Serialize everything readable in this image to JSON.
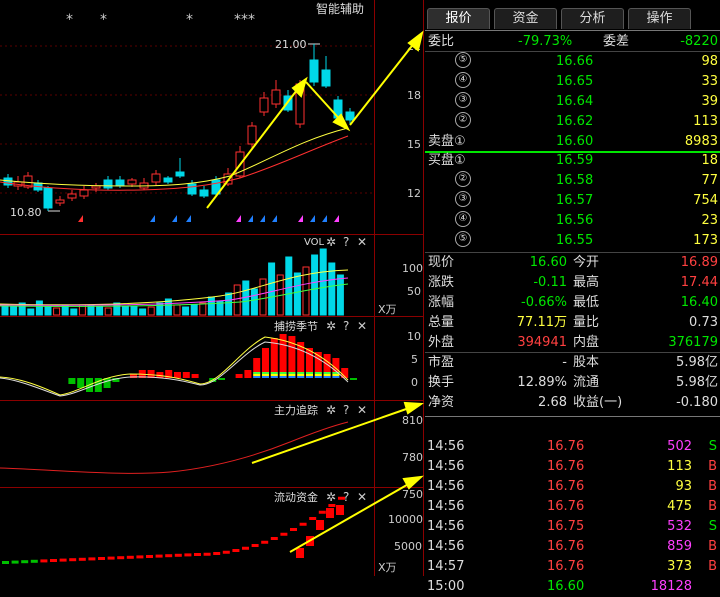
{
  "left": {
    "kline": {
      "title": "智能辅助",
      "stars": [
        "*",
        "*",
        "*",
        "***"
      ],
      "ticks": [
        "21",
        "18",
        "15",
        "12"
      ],
      "high_label": "21.00",
      "low_label": "10.80"
    },
    "vol": {
      "title": "VOL",
      "ticks": [
        "100",
        "50"
      ],
      "unit": "X万"
    },
    "hunt": {
      "title": "捕捞季节",
      "ticks": [
        "10",
        "5",
        "0"
      ]
    },
    "main": {
      "title": "主力追踪",
      "ticks": [
        "810",
        "780",
        "750"
      ]
    },
    "flow": {
      "title": "流动资金",
      "ticks": [
        "10000",
        "5000"
      ],
      "unit": "X万"
    },
    "panel_icons": {
      "gear": "✲",
      "help": "?",
      "close": "✕"
    }
  },
  "right": {
    "tabs": [
      "报价",
      "资金",
      "分析",
      "操作"
    ],
    "weibi": {
      "label": "委比",
      "value": "-79.73%",
      "label2": "委差",
      "value2": "-8220"
    },
    "sell": [
      {
        "idx": "⑤",
        "price": "16.66",
        "vol": "98"
      },
      {
        "idx": "④",
        "price": "16.65",
        "vol": "33"
      },
      {
        "idx": "③",
        "price": "16.64",
        "vol": "39"
      },
      {
        "idx": "②",
        "price": "16.62",
        "vol": "113"
      },
      {
        "label": "卖盘①",
        "price": "16.60",
        "vol": "8983"
      }
    ],
    "buy": [
      {
        "label": "买盘①",
        "price": "16.59",
        "vol": "18"
      },
      {
        "idx": "②",
        "price": "16.58",
        "vol": "77"
      },
      {
        "idx": "③",
        "price": "16.57",
        "vol": "754"
      },
      {
        "idx": "④",
        "price": "16.56",
        "vol": "23"
      },
      {
        "idx": "⑤",
        "price": "16.55",
        "vol": "173"
      }
    ],
    "quote": [
      {
        "l1": "现价",
        "v1": "16.60",
        "c1": "g",
        "l2": "今开",
        "v2": "16.89",
        "c2": "r"
      },
      {
        "l1": "涨跌",
        "v1": "-0.11",
        "c1": "g",
        "l2": "最高",
        "v2": "17.44",
        "c2": "r"
      },
      {
        "l1": "涨幅",
        "v1": "-0.66%",
        "c1": "g",
        "l2": "最低",
        "v2": "16.40",
        "c2": "g"
      },
      {
        "l1": "总量",
        "v1": "77.11万",
        "c1": "y",
        "l2": "量比",
        "v2": "0.73",
        "c2": "w"
      },
      {
        "l1": "外盘",
        "v1": "394941",
        "c1": "r",
        "l2": "内盘",
        "v2": "376179",
        "c2": "g"
      }
    ],
    "fin": [
      {
        "l1": "市盈",
        "v1": "-",
        "l2": "股本",
        "v2": "5.98亿"
      },
      {
        "l1": "换手",
        "v1": "12.89%",
        "l2": "流通",
        "v2": "5.98亿"
      },
      {
        "l1": "净资",
        "v1": "2.68",
        "l2": "收益(一)",
        "v2": "-0.180"
      }
    ],
    "ticks": [
      {
        "t": "14:56",
        "p": "16.76",
        "pc": "r",
        "v": "502",
        "vc": "mg",
        "s": "S",
        "sc": "g"
      },
      {
        "t": "14:56",
        "p": "16.76",
        "pc": "r",
        "v": "113",
        "vc": "y",
        "s": "B",
        "sc": "r"
      },
      {
        "t": "14:56",
        "p": "16.76",
        "pc": "r",
        "v": "93",
        "vc": "y",
        "s": "B",
        "sc": "r"
      },
      {
        "t": "14:56",
        "p": "16.76",
        "pc": "r",
        "v": "475",
        "vc": "y",
        "s": "B",
        "sc": "r"
      },
      {
        "t": "14:56",
        "p": "16.75",
        "pc": "r",
        "v": "532",
        "vc": "mg",
        "s": "S",
        "sc": "g"
      },
      {
        "t": "14:56",
        "p": "16.76",
        "pc": "r",
        "v": "859",
        "vc": "mg",
        "s": "B",
        "sc": "r"
      },
      {
        "t": "14:57",
        "p": "16.76",
        "pc": "r",
        "v": "373",
        "vc": "y",
        "s": "B",
        "sc": "r"
      },
      {
        "t": "15:00",
        "p": "16.60",
        "pc": "g",
        "v": "18128",
        "vc": "mg",
        "s": "",
        "sc": "w"
      }
    ]
  },
  "colors": {
    "up": "#ff3030",
    "down": "#00d8e8",
    "green": "#00e600",
    "yellow": "#ffff00",
    "magenta": "#ff40ff",
    "grid": "#8b0000"
  }
}
